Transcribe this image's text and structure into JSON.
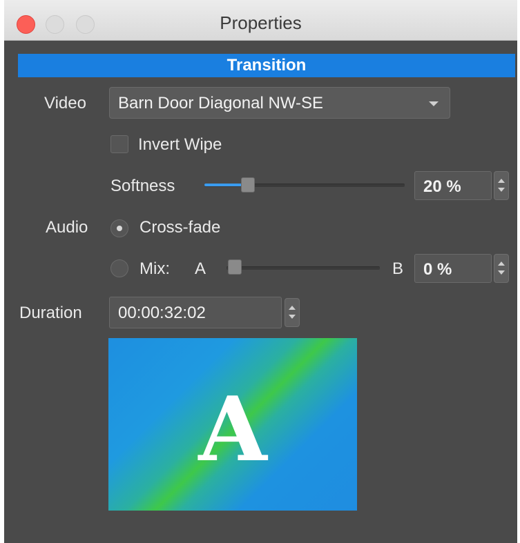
{
  "window": {
    "title": "Properties"
  },
  "transition": {
    "header": "Transition",
    "video_label": "Video",
    "video_value": "Barn Door Diagonal NW-SE",
    "invert_wipe_label": "Invert Wipe",
    "invert_wipe_checked": false,
    "softness_label": "Softness",
    "softness_value": "20 %",
    "softness_fraction": 0.2,
    "audio_label": "Audio",
    "crossfade_label": "Cross-fade",
    "crossfade_selected": true,
    "mix_label": "Mix:",
    "mix_a_label": "A",
    "mix_b_label": "B",
    "mix_value": "0 %",
    "mix_fraction": 0.0,
    "duration_label": "Duration",
    "duration_value": "00:00:32:02"
  },
  "preview": {
    "letter": "A",
    "colors": {
      "blue": "#1e8fe0",
      "green": "#3ec84a"
    }
  },
  "colors": {
    "accent": "#1a7fe0",
    "panel": "#4a4a4a",
    "close": "#fc5f57"
  }
}
